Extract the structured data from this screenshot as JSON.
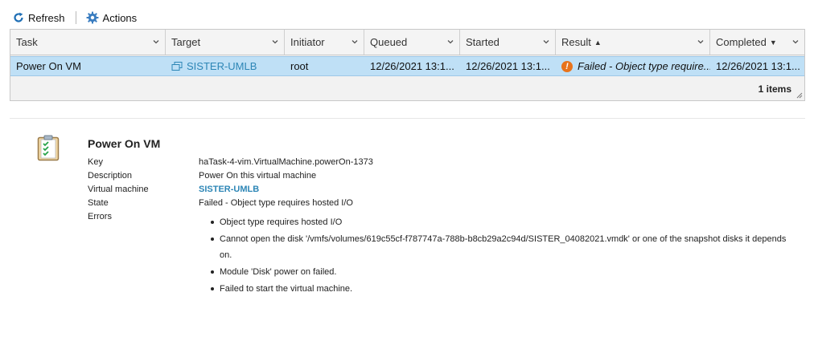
{
  "toolbar": {
    "refresh_label": "Refresh",
    "actions_label": "Actions"
  },
  "grid": {
    "columns": [
      {
        "label": "Task",
        "sort": ""
      },
      {
        "label": "Target",
        "sort": ""
      },
      {
        "label": "Initiator",
        "sort": ""
      },
      {
        "label": "Queued",
        "sort": ""
      },
      {
        "label": "Started",
        "sort": ""
      },
      {
        "label": "Result",
        "sort": "▲"
      },
      {
        "label": "Completed",
        "sort": "▼"
      }
    ],
    "rows": [
      {
        "task": "Power On VM",
        "target": "SISTER-UMLB",
        "initiator": "root",
        "queued": "12/26/2021 13:1...",
        "started": "12/26/2021 13:1...",
        "result": "Failed - Object type require...",
        "completed": "12/26/2021 13:1..."
      }
    ],
    "items_count": "1 items"
  },
  "details": {
    "title": "Power On VM",
    "fields": [
      {
        "key": "Key",
        "value": "haTask-4-vim.VirtualMachine.powerOn-1373"
      },
      {
        "key": "Description",
        "value": "Power On this virtual machine"
      },
      {
        "key": "Virtual machine",
        "value": "SISTER-UMLB"
      },
      {
        "key": "State",
        "value": "Failed - Object type requires hosted I/O"
      },
      {
        "key": "Errors",
        "value": ""
      }
    ],
    "errors": [
      "Object type requires hosted I/O",
      "Cannot open the disk '/vmfs/volumes/619c55cf-f787747a-788b-b8cb29a2c94d/SISTER_04082021.vmdk' or one of the snapshot disks it depends on.",
      "Module 'Disk' power on failed.",
      "Failed to start the virtual machine."
    ]
  },
  "colors": {
    "selected_row": "#bfe0f6",
    "link": "#2d86b6",
    "error_icon": "#e8731b"
  }
}
